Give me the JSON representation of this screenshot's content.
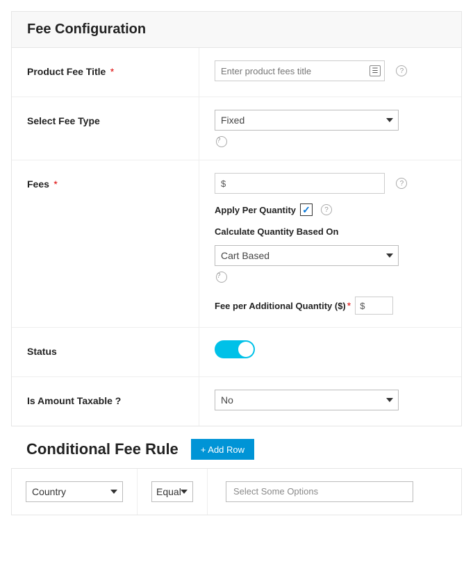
{
  "section1": {
    "title": "Fee Configuration",
    "productFeeTitle": {
      "label": "Product Fee Title",
      "required": true,
      "placeholder": "Enter product fees title",
      "value": ""
    },
    "selectFeeType": {
      "label": "Select Fee Type",
      "selected": "Fixed"
    },
    "fees": {
      "label": "Fees",
      "required": true,
      "value": "$",
      "applyPerQty": {
        "label": "Apply Per Quantity",
        "checked": true
      },
      "calcQtyBasedOn": {
        "label": "Calculate Quantity Based On",
        "selected": "Cart Based"
      },
      "feePerAdditional": {
        "label": "Fee per Additional Quantity ($)",
        "required": true,
        "value": "$"
      }
    },
    "status": {
      "label": "Status",
      "on": true
    },
    "taxable": {
      "label": "Is Amount Taxable ?",
      "selected": "No"
    }
  },
  "section2": {
    "title": "Conditional Fee Rule",
    "addRowLabel": "+ Add Row",
    "rule": {
      "fieldSelected": "Country",
      "operatorSelected": "Equal",
      "valuesPlaceholder": "Select Some Options"
    }
  }
}
